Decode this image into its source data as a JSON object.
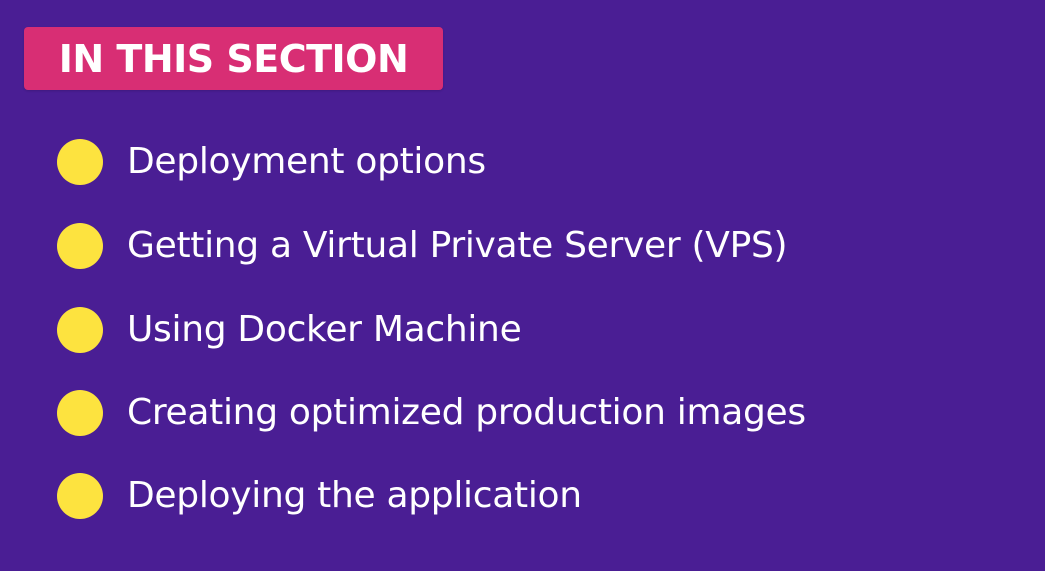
{
  "header": {
    "badge_label": "IN THIS SECTION"
  },
  "topics": [
    {
      "label": "Deployment options",
      "bullet_icon": "circle-bullet-icon"
    },
    {
      "label": "Getting a Virtual Private Server (VPS)",
      "bullet_icon": "circle-bullet-icon"
    },
    {
      "label": "Using Docker Machine",
      "bullet_icon": "circle-bullet-icon"
    },
    {
      "label": "Creating optimized production images",
      "bullet_icon": "circle-bullet-icon"
    },
    {
      "label": "Deploying the application",
      "bullet_icon": "circle-bullet-icon"
    }
  ],
  "colors": {
    "background": "#4a1e94",
    "badge": "#d82e74",
    "bullet": "#fde33f",
    "text": "#ffffff"
  }
}
